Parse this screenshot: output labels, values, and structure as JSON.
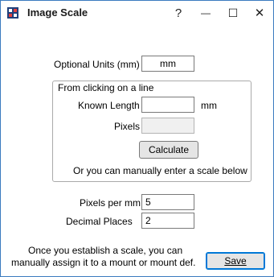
{
  "window": {
    "title": "Image Scale",
    "help_label": "?",
    "minimize_label": "—",
    "maximize_label": "☐",
    "close_label": "✕"
  },
  "units": {
    "label": "Optional Units (mm)",
    "value": "mm"
  },
  "line_group": {
    "caption": "From clicking on a line",
    "known_length_label": "Known Length",
    "known_length_value": "",
    "known_length_unit": "mm",
    "pixels_label": "Pixels",
    "pixels_value": "",
    "calculate_label": "Calculate",
    "hint": "Or you can manually enter a scale below"
  },
  "pixels_per_mm": {
    "label": "Pixels per mm",
    "value": "5"
  },
  "decimal_places": {
    "label": "Decimal Places",
    "value": "2"
  },
  "footer": {
    "note_line1": "Once you establish a scale, you can",
    "note_line2": "manually assign it to a mount or mount def.",
    "save_label": "Save"
  }
}
